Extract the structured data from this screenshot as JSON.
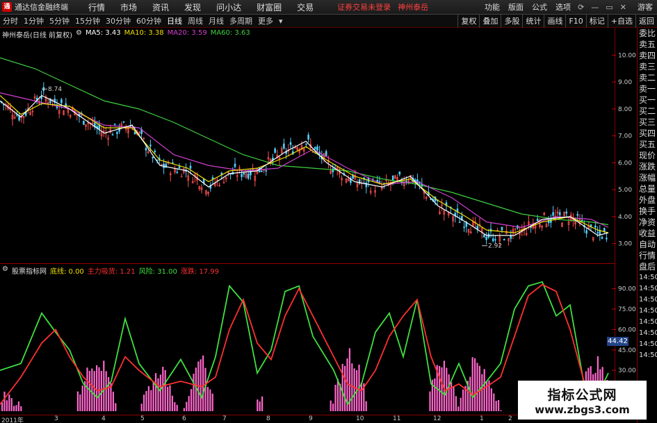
{
  "titlebar": {
    "logo": "通",
    "app_name": "通达信金融终端",
    "menu": [
      "行情",
      "市场",
      "资讯",
      "发现",
      "问小达",
      "财富圈",
      "交易"
    ],
    "notice": "证券交易未登录",
    "notice2": "神州泰岳",
    "right_menu": [
      "功能",
      "版面",
      "公式",
      "选项"
    ],
    "guest": "游客"
  },
  "toolbar": {
    "periods": [
      "分时",
      "1分钟",
      "5分钟",
      "15分钟",
      "30分钟",
      "60分钟",
      "日线",
      "周线",
      "月线",
      "多周期",
      "更多"
    ],
    "active_period": "日线",
    "tools": [
      "复权",
      "叠加",
      "多股",
      "统计",
      "画线",
      "F10",
      "标记",
      "+自选",
      "返回"
    ]
  },
  "main_panel": {
    "stock_label": "神州泰岳(日线 前复权)",
    "ma": [
      {
        "name": "MA5",
        "value": "3.43",
        "color": "#ffffff"
      },
      {
        "name": "MA10",
        "value": "3.38",
        "color": "#f0e000"
      },
      {
        "name": "MA20",
        "value": "3.59",
        "color": "#d040d0"
      },
      {
        "name": "MA60",
        "value": "3.63",
        "color": "#40d040"
      }
    ],
    "high_label": "8.74",
    "low_label": "2.92",
    "y_ticks": [
      "10.00",
      "9.00",
      "8.00",
      "7.00",
      "6.00",
      "5.00",
      "4.00",
      "3.00"
    ]
  },
  "sub_panel": {
    "indicator_name": "股票指标网",
    "params": [
      {
        "name": "底线",
        "value": "0.00",
        "color": "#f0e000"
      },
      {
        "name": "主力吸货",
        "value": "1.21",
        "color": "#ff3030"
      },
      {
        "name": "风险",
        "value": "31.00",
        "color": "#40e040"
      },
      {
        "name": "涨跌",
        "value": "17.99",
        "color": "#ff3030"
      }
    ],
    "y_ticks": [
      "90.00",
      "75.00",
      "60.00",
      "45.00",
      "30.00"
    ],
    "price_tag": "44.42"
  },
  "quote_panel": [
    "委比",
    "卖五",
    "卖四",
    "卖三",
    "卖二",
    "卖一",
    "买一",
    "买二",
    "买三",
    "买四",
    "买五",
    "现价",
    "涨跌",
    "涨幅",
    "总量",
    "外盘",
    "换手",
    "净资",
    "收益",
    "自动",
    "行情",
    "盘后",
    "14:50",
    "14:50",
    "14:50",
    "14:50",
    "14:50",
    "14:50",
    "14:50",
    "14:50"
  ],
  "date_axis": [
    "2011年",
    "3",
    "4",
    "5",
    "6",
    "7",
    "8",
    "9",
    "10",
    "11",
    "12",
    "1",
    "2"
  ],
  "watermark": {
    "line1": "指标公式网",
    "line2": "www.zbgs3.com"
  },
  "chart_data": {
    "type": "line",
    "price_ylim": [
      2.5,
      10.5
    ],
    "ma60": [
      [
        0,
        9.9
      ],
      [
        50,
        9.5
      ],
      [
        100,
        8.9
      ],
      [
        150,
        8.3
      ],
      [
        200,
        8.0
      ],
      [
        250,
        7.5
      ],
      [
        300,
        6.9
      ],
      [
        350,
        6.3
      ],
      [
        400,
        5.9
      ],
      [
        450,
        5.8
      ],
      [
        500,
        5.7
      ],
      [
        550,
        5.4
      ],
      [
        600,
        5.2
      ],
      [
        650,
        4.9
      ],
      [
        700,
        4.5
      ],
      [
        750,
        4.1
      ],
      [
        800,
        3.9
      ],
      [
        850,
        3.8
      ],
      [
        875,
        3.7
      ]
    ],
    "ma20": [
      [
        0,
        8.6
      ],
      [
        50,
        8.3
      ],
      [
        100,
        8.0
      ],
      [
        150,
        7.4
      ],
      [
        200,
        7.3
      ],
      [
        250,
        6.3
      ],
      [
        300,
        5.9
      ],
      [
        350,
        5.7
      ],
      [
        400,
        5.8
      ],
      [
        450,
        6.5
      ],
      [
        500,
        5.8
      ],
      [
        550,
        5.2
      ],
      [
        600,
        5.3
      ],
      [
        650,
        4.7
      ],
      [
        700,
        3.8
      ],
      [
        750,
        3.6
      ],
      [
        800,
        4.0
      ],
      [
        850,
        3.9
      ],
      [
        875,
        3.6
      ]
    ],
    "ma10": [
      [
        0,
        8.5
      ],
      [
        30,
        7.8
      ],
      [
        60,
        8.2
      ],
      [
        100,
        8.1
      ],
      [
        150,
        7.3
      ],
      [
        190,
        7.3
      ],
      [
        230,
        6.1
      ],
      [
        270,
        5.8
      ],
      [
        300,
        5.3
      ],
      [
        330,
        5.7
      ],
      [
        370,
        5.8
      ],
      [
        410,
        6.2
      ],
      [
        440,
        6.6
      ],
      [
        470,
        6.1
      ],
      [
        510,
        5.5
      ],
      [
        550,
        5.2
      ],
      [
        590,
        5.4
      ],
      [
        630,
        4.6
      ],
      [
        670,
        4.0
      ],
      [
        700,
        3.5
      ],
      [
        740,
        3.4
      ],
      [
        780,
        3.8
      ],
      [
        820,
        4.0
      ],
      [
        860,
        3.5
      ],
      [
        875,
        3.4
      ]
    ],
    "ma5": [
      [
        0,
        8.3
      ],
      [
        30,
        7.7
      ],
      [
        60,
        8.5
      ],
      [
        100,
        8.0
      ],
      [
        150,
        7.1
      ],
      [
        190,
        7.4
      ],
      [
        230,
        5.9
      ],
      [
        270,
        5.7
      ],
      [
        300,
        5.1
      ],
      [
        330,
        5.6
      ],
      [
        370,
        5.7
      ],
      [
        410,
        6.4
      ],
      [
        440,
        6.8
      ],
      [
        470,
        6.0
      ],
      [
        510,
        5.3
      ],
      [
        550,
        5.1
      ],
      [
        590,
        5.5
      ],
      [
        630,
        4.4
      ],
      [
        670,
        3.8
      ],
      [
        700,
        3.3
      ],
      [
        740,
        3.3
      ],
      [
        780,
        3.9
      ],
      [
        820,
        4.0
      ],
      [
        860,
        3.3
      ],
      [
        875,
        3.4
      ]
    ],
    "sub_ylim": [
      0,
      100
    ],
    "green_line": [
      [
        0,
        30
      ],
      [
        30,
        35
      ],
      [
        60,
        72
      ],
      [
        80,
        58
      ],
      [
        100,
        45
      ],
      [
        120,
        20
      ],
      [
        140,
        10
      ],
      [
        160,
        22
      ],
      [
        180,
        68
      ],
      [
        200,
        35
      ],
      [
        230,
        15
      ],
      [
        260,
        38
      ],
      [
        290,
        10
      ],
      [
        310,
        40
      ],
      [
        330,
        92
      ],
      [
        350,
        80
      ],
      [
        370,
        28
      ],
      [
        390,
        45
      ],
      [
        410,
        88
      ],
      [
        430,
        92
      ],
      [
        450,
        55
      ],
      [
        480,
        30
      ],
      [
        500,
        5
      ],
      [
        520,
        20
      ],
      [
        540,
        58
      ],
      [
        560,
        72
      ],
      [
        580,
        40
      ],
      [
        600,
        82
      ],
      [
        620,
        20
      ],
      [
        640,
        12
      ],
      [
        660,
        35
      ],
      [
        680,
        10
      ],
      [
        700,
        22
      ],
      [
        720,
        35
      ],
      [
        740,
        75
      ],
      [
        760,
        92
      ],
      [
        780,
        95
      ],
      [
        800,
        70
      ],
      [
        820,
        78
      ],
      [
        840,
        20
      ],
      [
        860,
        12
      ],
      [
        875,
        28
      ]
    ],
    "red_line": [
      [
        0,
        5
      ],
      [
        30,
        25
      ],
      [
        60,
        50
      ],
      [
        80,
        60
      ],
      [
        100,
        40
      ],
      [
        120,
        25
      ],
      [
        140,
        15
      ],
      [
        160,
        18
      ],
      [
        180,
        40
      ],
      [
        200,
        30
      ],
      [
        230,
        18
      ],
      [
        260,
        22
      ],
      [
        290,
        18
      ],
      [
        310,
        25
      ],
      [
        330,
        60
      ],
      [
        350,
        82
      ],
      [
        370,
        50
      ],
      [
        390,
        38
      ],
      [
        410,
        70
      ],
      [
        430,
        90
      ],
      [
        450,
        70
      ],
      [
        480,
        40
      ],
      [
        500,
        20
      ],
      [
        520,
        15
      ],
      [
        540,
        30
      ],
      [
        560,
        55
      ],
      [
        580,
        70
      ],
      [
        600,
        82
      ],
      [
        620,
        40
      ],
      [
        640,
        15
      ],
      [
        660,
        20
      ],
      [
        680,
        12
      ],
      [
        700,
        18
      ],
      [
        720,
        25
      ],
      [
        740,
        55
      ],
      [
        760,
        85
      ],
      [
        780,
        93
      ],
      [
        800,
        88
      ],
      [
        820,
        60
      ],
      [
        840,
        22
      ],
      [
        860,
        8
      ],
      [
        875,
        5
      ]
    ]
  }
}
